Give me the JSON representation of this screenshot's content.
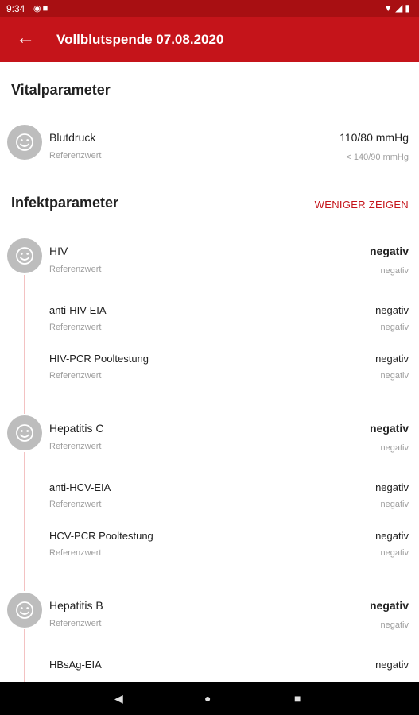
{
  "status_bar": {
    "time": "9:34",
    "icons": [
      "signal-icon",
      "wifi-icon",
      "battery-icon"
    ]
  },
  "app_bar": {
    "back_icon": "arrow-back-icon",
    "title": "Vollblutspende 07.08.2020",
    "color": "#c5141a"
  },
  "vital": {
    "title": "Vitalparameter",
    "items": [
      {
        "name": "Blutdruck",
        "ref_label": "Referenzwert",
        "value": "110/80 mmHg",
        "ref_value": "< 140/90 mmHg"
      }
    ]
  },
  "infekt": {
    "title": "Infektparameter",
    "toggle_label": "WENIGER ZEIGEN",
    "groups": [
      {
        "name": "HIV",
        "ref_label": "Referenzwert",
        "value": "negativ",
        "ref_value": "negativ",
        "children": [
          {
            "name": "anti-HIV-EIA",
            "ref_label": "Referenzwert",
            "value": "negativ",
            "ref_value": "negativ"
          },
          {
            "name": "HIV-PCR Pooltestung",
            "ref_label": "Referenzwert",
            "value": "negativ",
            "ref_value": "negativ"
          }
        ]
      },
      {
        "name": "Hepatitis C",
        "ref_label": "Referenzwert",
        "value": "negativ",
        "ref_value": "negativ",
        "children": [
          {
            "name": "anti-HCV-EIA",
            "ref_label": "Referenzwert",
            "value": "negativ",
            "ref_value": "negativ"
          },
          {
            "name": "HCV-PCR Pooltestung",
            "ref_label": "Referenzwert",
            "value": "negativ",
            "ref_value": "negativ"
          }
        ]
      },
      {
        "name": "Hepatitis B",
        "ref_label": "Referenzwert",
        "value": "negativ",
        "ref_value": "negativ",
        "children": [
          {
            "name": "HBsAg-EIA",
            "value": "negativ"
          }
        ]
      }
    ]
  },
  "nav_bar": {
    "icons": [
      "back-triangle-icon",
      "home-circle-icon",
      "recents-square-icon"
    ]
  }
}
